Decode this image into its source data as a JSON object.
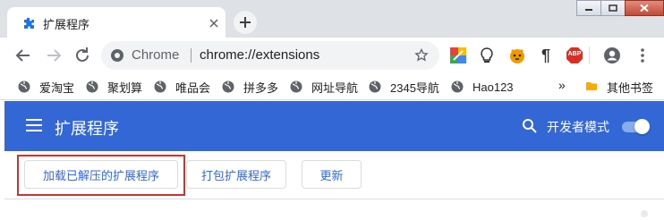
{
  "tab": {
    "title": "扩展程序",
    "favicon": "puzzle-icon"
  },
  "window_controls": [
    "minimize-icon",
    "maximize-icon",
    "close-icon"
  ],
  "omnibox": {
    "site_label": "Chrome",
    "url": "chrome://extensions"
  },
  "extensions": [
    "color-ext-icon",
    "bulb-ext-icon",
    "tiger-ext-icon",
    "pilcrow-ext-icon",
    "abp-ext-icon"
  ],
  "extension_labels": {
    "pilcrow": "¶",
    "abp": "ABP"
  },
  "bookmarks": {
    "items": [
      {
        "label": "爱淘宝"
      },
      {
        "label": "聚划算"
      },
      {
        "label": "唯品会"
      },
      {
        "label": "拼多多"
      },
      {
        "label": "网址导航"
      },
      {
        "label": "2345导航"
      },
      {
        "label": "Hao123"
      }
    ],
    "more": "»",
    "other": "其他书签"
  },
  "header": {
    "title": "扩展程序",
    "dev_mode_label": "开发者模式",
    "dev_mode_on": true,
    "color": "#3367d6"
  },
  "actions": {
    "load_unpacked": "加载已解压的扩展程序",
    "pack": "打包扩展程序",
    "update": "更新"
  },
  "colors": {
    "accent": "#3367d6",
    "highlight": "#c53533"
  }
}
